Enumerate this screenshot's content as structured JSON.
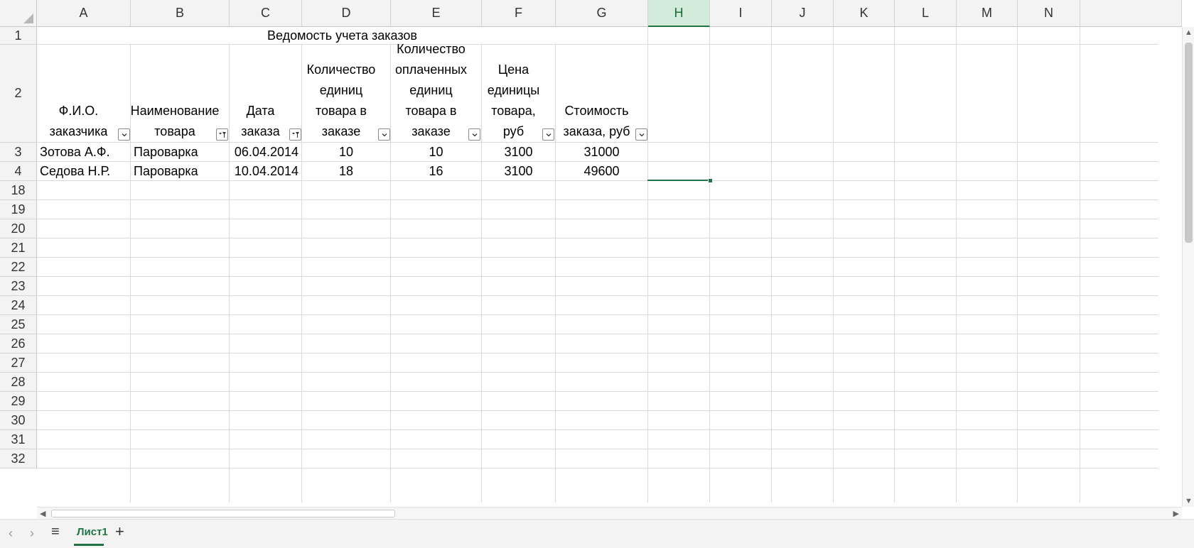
{
  "columns": [
    "A",
    "B",
    "C",
    "D",
    "E",
    "F",
    "G",
    "H",
    "I",
    "J",
    "K",
    "L",
    "M",
    "N"
  ],
  "selected_column": "H",
  "row_numbers": [
    "1",
    "2",
    "3",
    "4",
    "18",
    "19",
    "20",
    "21",
    "22",
    "23",
    "24",
    "25",
    "26",
    "27",
    "28",
    "29",
    "30",
    "31",
    "32"
  ],
  "title": "Ведомость учета заказов",
  "headers": [
    {
      "lines": [
        "Ф.И.О.",
        "заказчика"
      ],
      "filter": "dropdown"
    },
    {
      "lines": [
        "Наименование",
        "товара"
      ],
      "filter": "filtered"
    },
    {
      "lines": [
        "Дата",
        "заказа"
      ],
      "filter": "filtered"
    },
    {
      "lines": [
        "Количество",
        "единиц",
        "товара в",
        "заказе"
      ],
      "filter": "dropdown"
    },
    {
      "lines": [
        "Количество",
        "оплаченных",
        "единиц",
        "товара в",
        "заказе"
      ],
      "filter": "dropdown"
    },
    {
      "lines": [
        "Цена",
        "единицы",
        "товара,",
        "руб"
      ],
      "filter": "dropdown"
    },
    {
      "lines": [
        "Стоимость",
        "заказа, руб"
      ],
      "filter": "dropdown"
    }
  ],
  "rows": [
    {
      "fio": "Зотова А.Ф.",
      "product": "Пароварка",
      "date": "06.04.2014",
      "qty": "10",
      "paid": "10",
      "price": "3100",
      "total": "31000"
    },
    {
      "fio": "Седова Н.Р.",
      "product": "Пароварка",
      "date": "10.04.2014",
      "qty": "18",
      "paid": "16",
      "price": "3100",
      "total": "49600"
    }
  ],
  "sheet_tab": "Лист1",
  "icons": {
    "dropdown": "chevron-down-icon",
    "filtered": "filter-icon",
    "prev": "chevron-left-icon",
    "next": "chevron-right-icon",
    "menu": "hamburger-icon",
    "add": "plus-icon"
  },
  "colors": {
    "accent": "#217346",
    "selected_header_bg": "#d2ecdb",
    "gridline": "#dadada"
  }
}
